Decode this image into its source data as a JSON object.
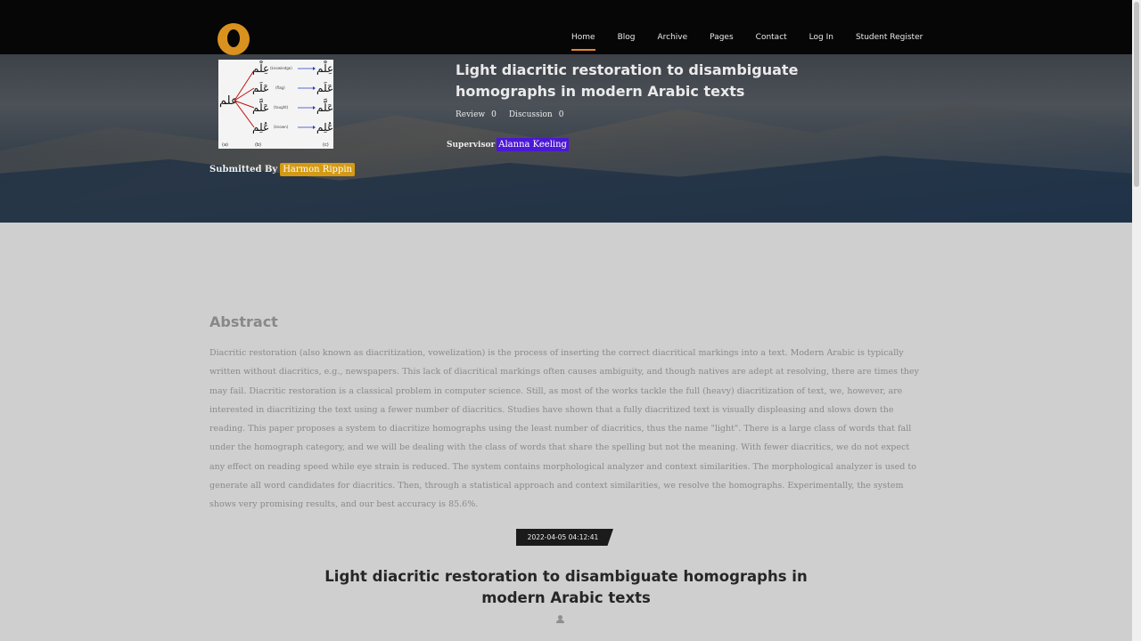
{
  "nav": {
    "logo": "logo-icon",
    "items": [
      "Home",
      "Blog",
      "Archive",
      "Pages",
      "Contact",
      "Log In",
      "Student Register"
    ],
    "active": "Home"
  },
  "hero": {
    "title": "Light diacritic restoration to disambiguate homographs in modern Arabic texts",
    "review_label": "Review",
    "review_count": "0",
    "discussion_label": "Discussion",
    "discussion_count": "0",
    "supervisor_label": "Supervisor",
    "supervisor_name": "Alanna Keeling",
    "submitted_label": "Submitted By",
    "submitted_name": "Harmon Rippin",
    "thumbnail": {
      "root_word": "علم",
      "rows": [
        {
          "word": "عِلْم",
          "gloss": "(knowledge)",
          "result": "عِلْم"
        },
        {
          "word": "عَلَم",
          "gloss": "(flag)",
          "result": "عَلَم"
        },
        {
          "word": "عَلَّم",
          "gloss": "(taught)",
          "result": "عَلَّم"
        },
        {
          "word": "عُلِم",
          "gloss": "(known)",
          "result": "عُلِم"
        }
      ],
      "captions": [
        "(a)",
        "(b)",
        "(c)"
      ]
    }
  },
  "abstract": {
    "heading": "Abstract",
    "text": "Diacritic restoration (also known as diacritization, vowelization) is the process of inserting the correct diacritical markings into a text. Modern Arabic is typically written without diacritics, e.g., newspapers. This lack of diacritical markings often causes ambiguity, and though natives are adept at resolving, there are times they may fail. Diacritic restoration is a classical problem in computer science. Still, as most of the works tackle the full (heavy) diacritization of text, we, however, are interested in diacritizing the text using a fewer number of diacritics. Studies have shown that a fully diacritized text is visually displeasing and slows down the reading. This paper proposes a system to diacritize homographs using the least number of diacritics, thus the name \"light\". There is a large class of words that fall under the homograph category, and we will be dealing with the class of words that share the spelling but not the meaning. With fewer diacritics, we do not expect any effect on reading speed while eye strain is reduced. The system contains morphological analyzer and context similarities. The morphological analyzer is used to generate all word candidates for diacritics. Then, through a statistical approach and context similarities, we resolve the homographs. Experimentally, the system shows very promising results, and our best accuracy is 85.6%."
  },
  "post": {
    "date": "2022-04-05 04:12:41",
    "title": "Light diacritic restoration to disambiguate homographs in modern Arabic texts",
    "author_icon": "user-icon"
  },
  "colors": {
    "nav_bg": "#060606",
    "accent": "#e8852e",
    "submitter_badge": "#d59a14",
    "supervisor_badge": "#4b18d4"
  }
}
